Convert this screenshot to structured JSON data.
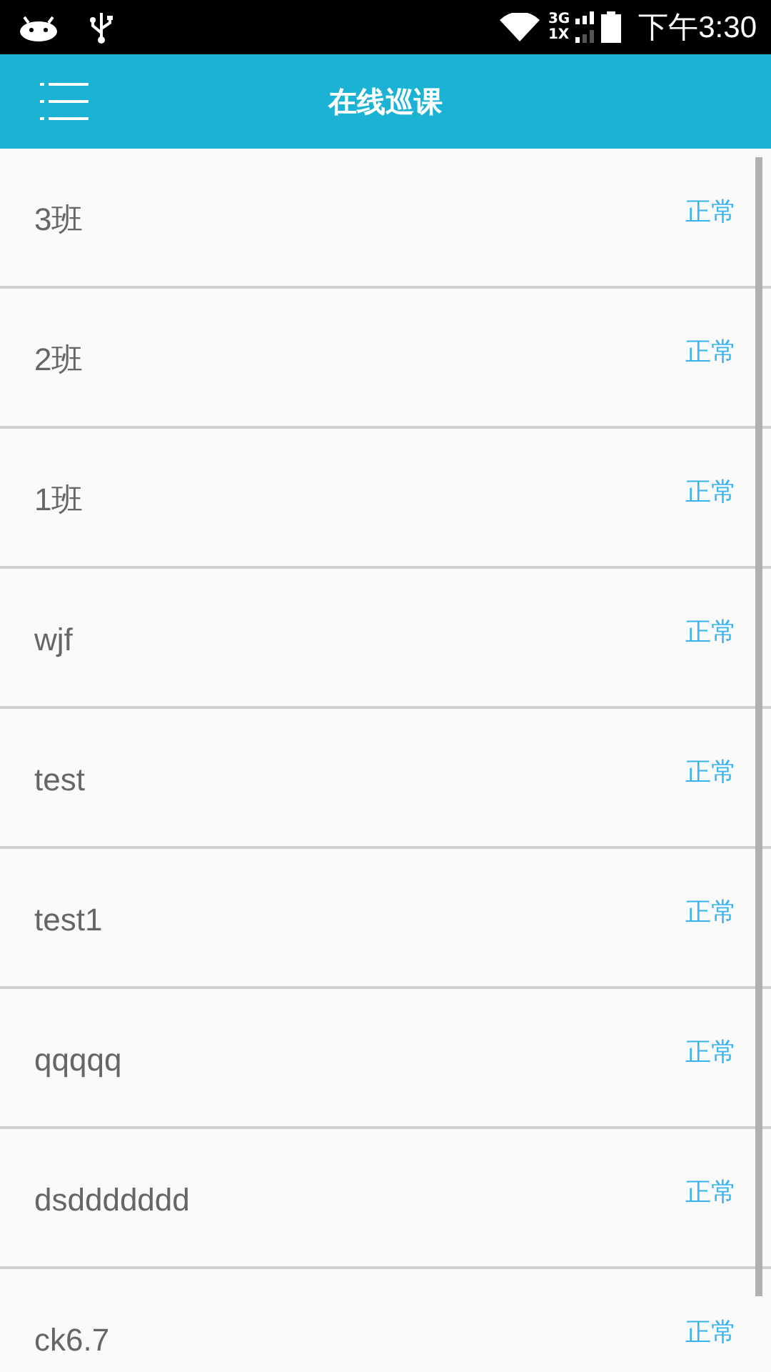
{
  "status_bar": {
    "network_top": "3G",
    "network_bottom": "1X",
    "time": "下午3:30"
  },
  "app_bar": {
    "title": "在线巡课"
  },
  "classes": [
    {
      "name": "3班",
      "status": "正常"
    },
    {
      "name": "2班",
      "status": "正常"
    },
    {
      "name": "1班",
      "status": "正常"
    },
    {
      "name": "wjf",
      "status": "正常"
    },
    {
      "name": "test",
      "status": "正常"
    },
    {
      "name": "test1",
      "status": "正常"
    },
    {
      "name": "qqqqq",
      "status": "正常"
    },
    {
      "name": "dsddddddd",
      "status": "正常"
    },
    {
      "name": "ck6.7",
      "status": "正常"
    }
  ]
}
